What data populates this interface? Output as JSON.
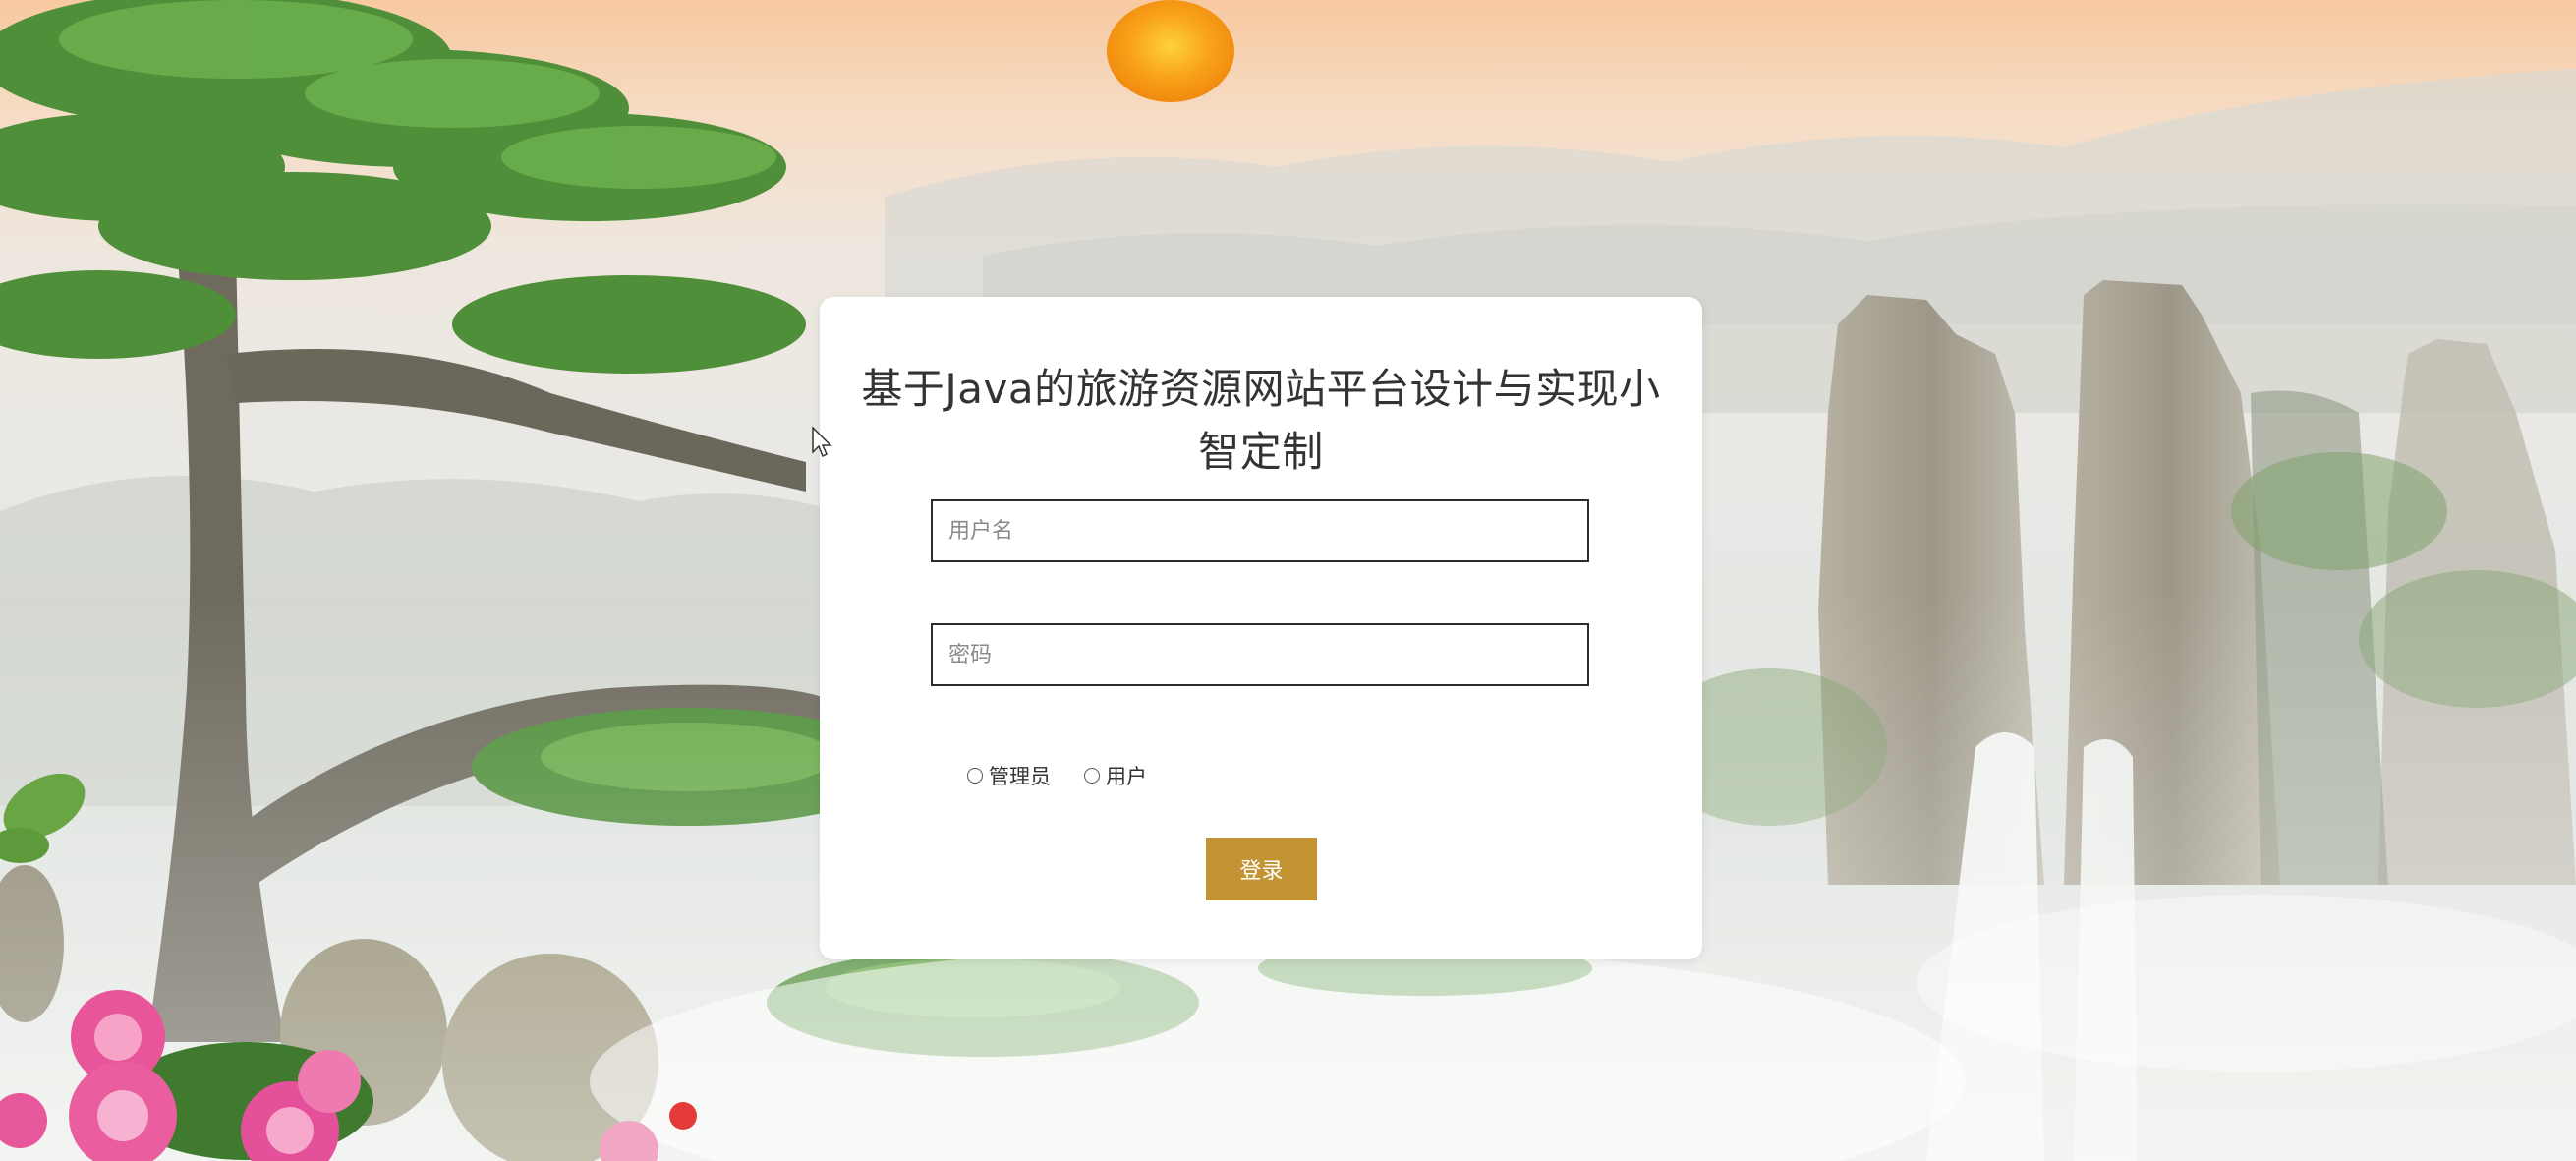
{
  "page": {
    "title": "基于Java的旅游资源网站平台设计与实现小智定制"
  },
  "form": {
    "username_placeholder": "用户名",
    "password_placeholder": "密码",
    "username_value": "",
    "password_value": "",
    "roles": [
      {
        "label": "管理员",
        "selected": false
      },
      {
        "label": "用户",
        "selected": false
      }
    ],
    "submit_label": "登录"
  },
  "colors": {
    "accent": "#c49434",
    "card_background": "#ffffff",
    "title_text": "#333333"
  }
}
